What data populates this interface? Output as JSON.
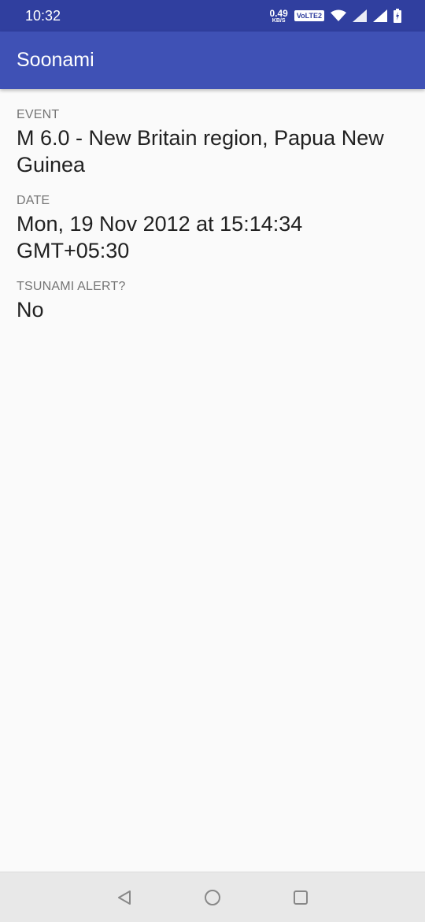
{
  "status_bar": {
    "time": "10:32",
    "speed_value": "0.49",
    "speed_unit": "KB/S",
    "volte_label": "VoLTE2",
    "icons": [
      "wifi-icon",
      "signal-icon",
      "signal-icon",
      "battery-charging-icon"
    ]
  },
  "app_bar": {
    "title": "Soonami",
    "color": "#3f51b5"
  },
  "details": {
    "event_label": "EVENT",
    "event_value": "M 6.0 - New Britain region, Papua New Guinea",
    "date_label": "DATE",
    "date_value": "Mon, 19 Nov 2012 at 15:14:34 GMT+05:30",
    "tsunami_label": "TSUNAMI ALERT?",
    "tsunami_value": "No"
  },
  "nav_bar": {
    "icons": [
      "back-icon",
      "home-icon",
      "recents-icon"
    ]
  }
}
